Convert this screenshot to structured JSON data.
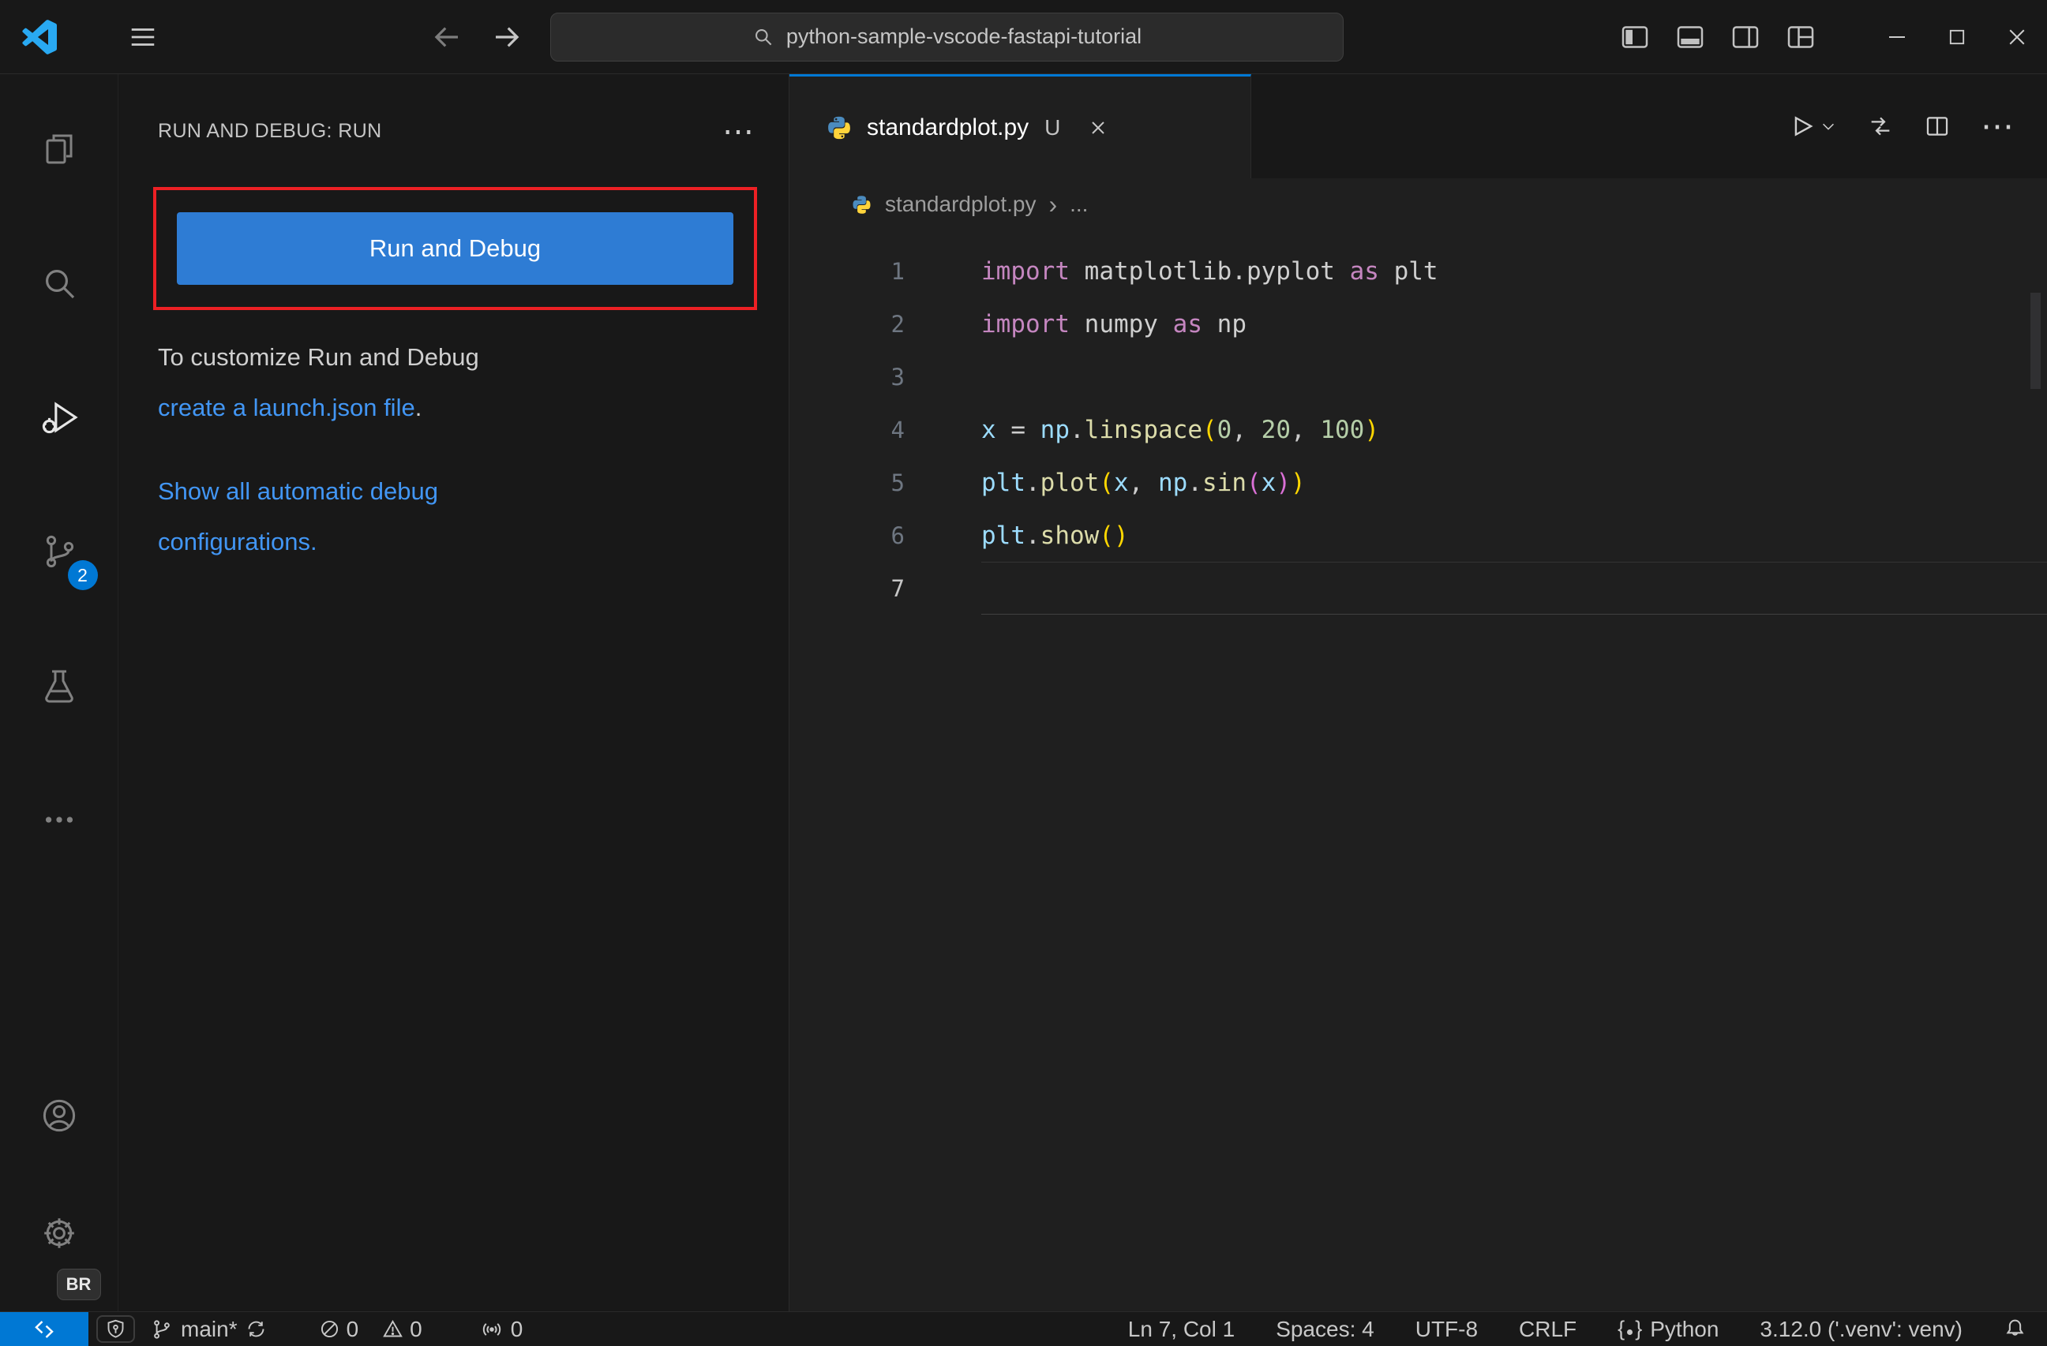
{
  "colors": {
    "accent": "#0078d4",
    "titlebar_bg": "#181818",
    "editor_bg": "#1f1f1f",
    "panel_bg": "#181818",
    "button_blue": "#2e7cd4",
    "link_blue": "#4296f4",
    "annotation_red": "#ed2024",
    "logo_blue": "#29a9f2",
    "badge_blue": "#0078d4"
  },
  "window": {
    "search_value": "python-sample-vscode-fastapi-tutorial"
  },
  "activity_bar": {
    "source_control_badge": "2",
    "profile_badge": "BR"
  },
  "sidebar": {
    "title": "RUN AND DEBUG: RUN",
    "more_glyph": "⋯",
    "run_button": "Run and Debug",
    "welcome": [
      {
        "lines": [
          [
            {
              "text": "To customize Run and Debug"
            }
          ],
          [
            {
              "text": "create a launch.json file",
              "link": true
            },
            {
              "text": "."
            }
          ]
        ]
      },
      {
        "lines": [
          [
            {
              "text": "Show all automatic debug",
              "link": true
            }
          ],
          [
            {
              "text": "configurations.",
              "link": true
            }
          ]
        ]
      }
    ]
  },
  "editor": {
    "tab": {
      "label": "standardplot.py",
      "git_status": "U"
    },
    "more_glyph": "⋯",
    "breadcrumb": {
      "file": "standardplot.py",
      "more": "..."
    },
    "code": {
      "active_line": 7,
      "lines": [
        {
          "n": 1,
          "tokens": [
            {
              "t": "import",
              "c": "kw"
            },
            {
              "t": " ",
              "c": "pl"
            },
            {
              "t": "matplotlib.pyplot",
              "c": "mod"
            },
            {
              "t": " ",
              "c": "pl"
            },
            {
              "t": "as",
              "c": "kw"
            },
            {
              "t": " ",
              "c": "pl"
            },
            {
              "t": "plt",
              "c": "mod"
            }
          ]
        },
        {
          "n": 2,
          "tokens": [
            {
              "t": "import",
              "c": "kw"
            },
            {
              "t": " ",
              "c": "pl"
            },
            {
              "t": "numpy",
              "c": "mod"
            },
            {
              "t": " ",
              "c": "pl"
            },
            {
              "t": "as",
              "c": "kw"
            },
            {
              "t": " ",
              "c": "pl"
            },
            {
              "t": "np",
              "c": "mod"
            }
          ]
        },
        {
          "n": 3,
          "tokens": []
        },
        {
          "n": 4,
          "tokens": [
            {
              "t": "x",
              "c": "var"
            },
            {
              "t": " = ",
              "c": "pl"
            },
            {
              "t": "np",
              "c": "var"
            },
            {
              "t": ".",
              "c": "pl"
            },
            {
              "t": "linspace",
              "c": "fn"
            },
            {
              "t": "(",
              "c": "b1"
            },
            {
              "t": "0",
              "c": "num"
            },
            {
              "t": ", ",
              "c": "pl"
            },
            {
              "t": "20",
              "c": "num"
            },
            {
              "t": ", ",
              "c": "pl"
            },
            {
              "t": "100",
              "c": "num"
            },
            {
              "t": ")",
              "c": "b1"
            }
          ]
        },
        {
          "n": 5,
          "tokens": [
            {
              "t": "plt",
              "c": "var"
            },
            {
              "t": ".",
              "c": "pl"
            },
            {
              "t": "plot",
              "c": "fn"
            },
            {
              "t": "(",
              "c": "b1"
            },
            {
              "t": "x",
              "c": "var"
            },
            {
              "t": ", ",
              "c": "pl"
            },
            {
              "t": "np",
              "c": "var"
            },
            {
              "t": ".",
              "c": "pl"
            },
            {
              "t": "sin",
              "c": "fn"
            },
            {
              "t": "(",
              "c": "b2"
            },
            {
              "t": "x",
              "c": "var"
            },
            {
              "t": ")",
              "c": "b2"
            },
            {
              "t": ")",
              "c": "b1"
            }
          ]
        },
        {
          "n": 6,
          "tokens": [
            {
              "t": "plt",
              "c": "var"
            },
            {
              "t": ".",
              "c": "pl"
            },
            {
              "t": "show",
              "c": "fn"
            },
            {
              "t": "(",
              "c": "b1"
            },
            {
              "t": ")",
              "c": "b1"
            }
          ]
        },
        {
          "n": 7,
          "tokens": []
        }
      ]
    }
  },
  "status_bar": {
    "branch": "main*",
    "errors": "0",
    "warnings": "0",
    "ports": "0",
    "line_col": "Ln 7, Col 1",
    "indentation": "Spaces: 4",
    "encoding": "UTF-8",
    "eol": "CRLF",
    "language": "Python",
    "language_icon_left": "{",
    "language_icon_right": "}",
    "interpreter": "3.12.0 ('.venv': venv)"
  }
}
